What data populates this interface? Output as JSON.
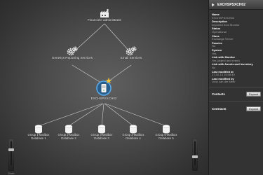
{
  "canvas": {
    "nodes": {
      "financiele": {
        "label": "Financiele administratie",
        "icon": "factory-icon"
      },
      "genesys": {
        "label": "Genesys Reporting Services",
        "icon": "gears-icon"
      },
      "email": {
        "label": "Email Services",
        "icon": "gears-icon"
      },
      "server": {
        "label": "EXCHSPSXCH02",
        "icon": "server-icon"
      },
      "db1": {
        "line1": "Group 1-Mailbox",
        "line2": "Database 1",
        "icon": "database-icon"
      },
      "db2": {
        "line1": "Group 2-Mailbox",
        "line2": "Database 2",
        "icon": "database-icon"
      },
      "db3": {
        "line1": "Group 3-Mailbox",
        "line2": "Database 3",
        "icon": "database-icon"
      },
      "db4": {
        "line1": "Group 4-Mailbox",
        "line2": "Database 4",
        "icon": "database-icon"
      },
      "db5": {
        "line1": "Group 5-Mailbox",
        "line2": "Database 5",
        "icon": "database-icon"
      }
    },
    "zoom_left": {
      "caption": "Zoom"
    }
  },
  "panel": {
    "title": "EXCHSPSXCH02",
    "properties": [
      {
        "key": "Name",
        "value": "EXCHSPSXCH02"
      },
      {
        "key": "Description",
        "value": "Imported from Monitor"
      },
      {
        "key": "Status",
        "value": "Operational"
      },
      {
        "key": "Class",
        "value": "Exchange Server"
      },
      {
        "key": "Passive",
        "value": "No"
      },
      {
        "key": "System",
        "value": "Yes"
      },
      {
        "key": "Link with Monitor",
        "value": "Yes (object and event)"
      },
      {
        "key": "Link with Assets and Inventory",
        "value": "No"
      },
      {
        "key": "Last modified at",
        "value": "27-02-13 15:08:40"
      },
      {
        "key": "Last modified by",
        "value": "Leon van der Meer"
      }
    ],
    "contacts": {
      "label": "Contacts",
      "button": "Expand"
    },
    "contracts": {
      "label": "Contracts",
      "button": "Expand"
    }
  },
  "colors": {
    "accent_star": "#f0c23a",
    "server_ring": "#5aa9e6",
    "link_line": "#cfcfcf"
  }
}
